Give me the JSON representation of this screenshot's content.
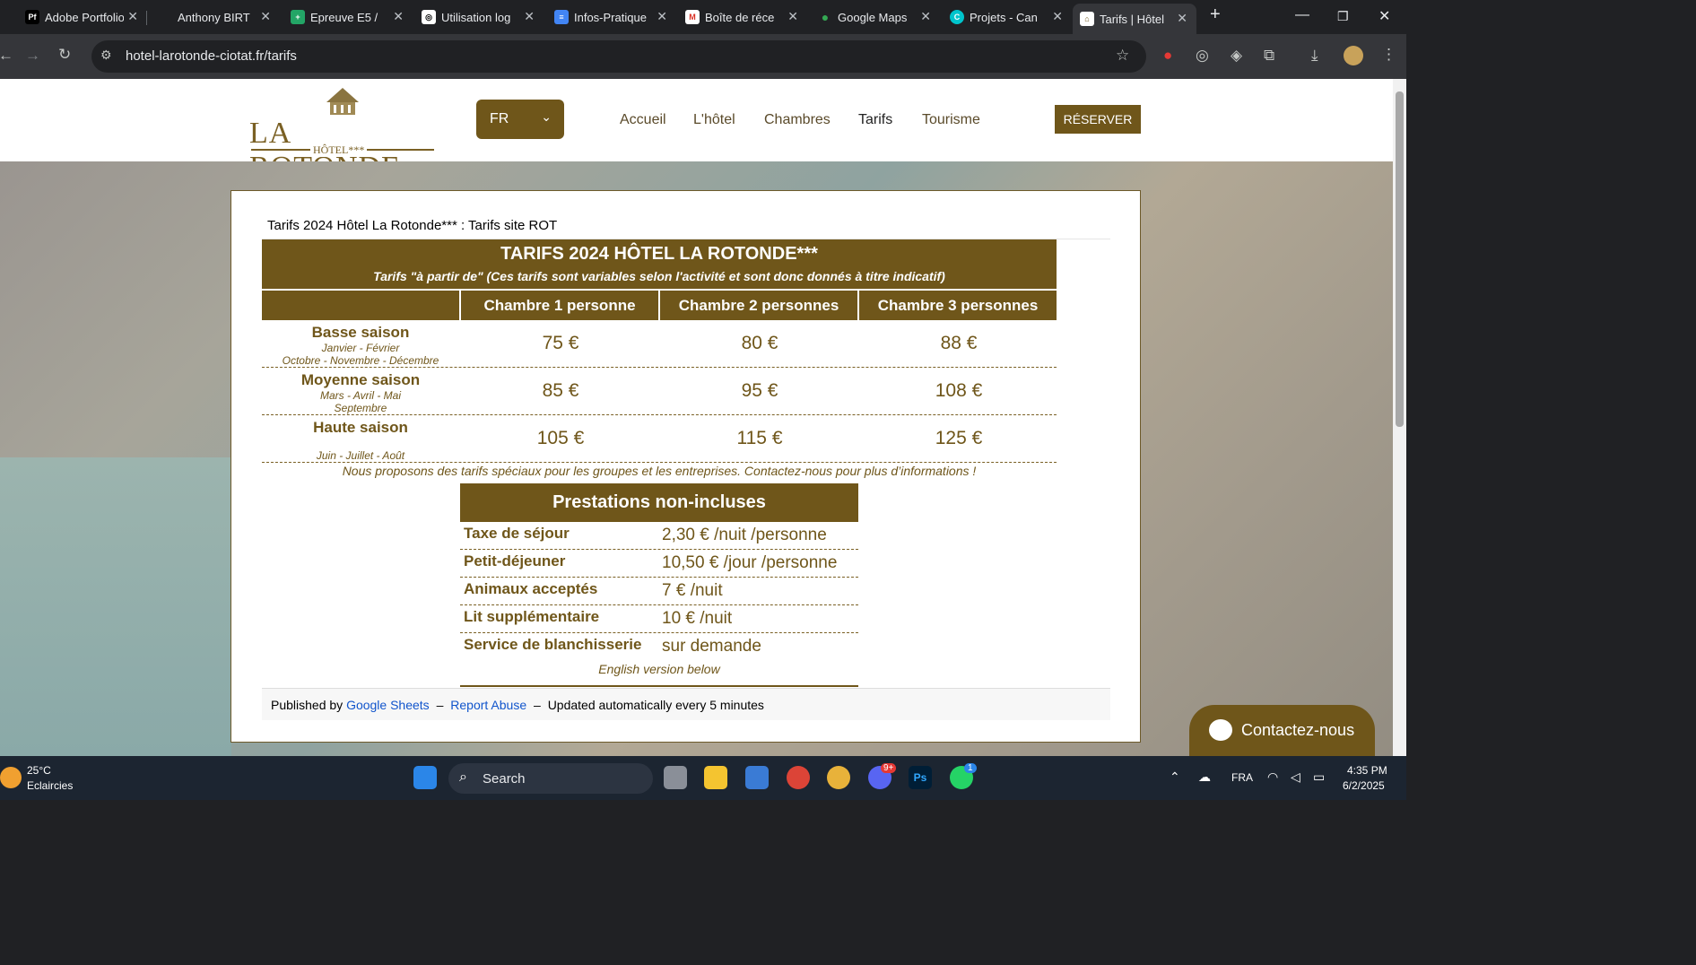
{
  "browser": {
    "tabs": [
      {
        "title": "Adobe Portfolio",
        "fav": "Pf",
        "color": "#000000"
      },
      {
        "title": "Anthony BIRT",
        "fav": "",
        "color": "#202124"
      },
      {
        "title": "Epreuve E5 /",
        "fav": "+",
        "color": "#23a566"
      },
      {
        "title": "Utilisation log",
        "fav": "◎",
        "color": "#202124"
      },
      {
        "title": "Infos-Pratique",
        "fav": "≡",
        "color": "#4285f4"
      },
      {
        "title": "Boîte de réce",
        "fav": "M",
        "color": "#202124"
      },
      {
        "title": "Google Maps",
        "fav": "●",
        "color": "#202124"
      },
      {
        "title": "Projets - Can",
        "fav": "C",
        "color": "#00c4cc"
      },
      {
        "title": "Tarifs | Hôtel",
        "fav": "⌂",
        "color": "#ffffff"
      }
    ],
    "new_tab": "+",
    "url": "hotel-larotonde-ciotat.fr/tarifs"
  },
  "site": {
    "logo_name": "LA ROTONDE",
    "logo_sub": "HÔTEL***",
    "lang": "FR",
    "nav": [
      "Accueil",
      "L'hôtel",
      "Chambres",
      "Tarifs",
      "Tourisme"
    ],
    "reserve": "RÉSERVER",
    "chat": "Contactez-nous"
  },
  "sheet": {
    "doc_title": "Tarifs 2024 Hôtel La Rotonde*** : Tarifs site ROT",
    "title": "TARIFS 2024 HÔTEL LA ROTONDE***",
    "subtitle": "Tarifs \"à partir de\" (Ces tarifs sont variables selon l'activité et sont donc donnés à titre indicatif)",
    "columns": [
      "Chambre 1 personne",
      "Chambre 2 personnes",
      "Chambre 3 personnes"
    ],
    "rows": [
      {
        "season": "Basse saison",
        "m1": "Janvier - Février",
        "m2": "Octobre - Novembre - Décembre",
        "p1": "75 €",
        "p2": "80 €",
        "p3": "88 €"
      },
      {
        "season": "Moyenne saison",
        "m1": "Mars - Avril - Mai",
        "m2": "Septembre",
        "p1": "85 €",
        "p2": "95 €",
        "p3": "108 €"
      },
      {
        "season": "Haute saison",
        "m1": "",
        "m2": "Juin - Juillet - Août",
        "p1": "105 €",
        "p2": "115 €",
        "p3": "125 €"
      }
    ],
    "note": "Nous proposons des tarifs spéciaux pour les groupes et les entreprises. Contactez-nous pour plus d’informations !",
    "prest_title": "Prestations non-incluses",
    "prestations": [
      {
        "k": "Taxe de séjour",
        "v": "2,30 € /nuit /personne"
      },
      {
        "k": "Petit-déjeuner",
        "v": "10,50 € /jour /personne"
      },
      {
        "k": "Animaux acceptés",
        "v": "7 € /nuit"
      },
      {
        "k": "Lit supplémentaire",
        "v": "10 € /nuit"
      },
      {
        "k": "Service de blanchisserie",
        "v": "sur demande"
      }
    ],
    "english": "English version below",
    "published_by": "Published by",
    "google_sheets": "Google Sheets",
    "dash": "–",
    "report_abuse": "Report Abuse",
    "updated": "Updated automatically every 5 minutes"
  },
  "taskbar": {
    "temp": "25°C",
    "weather": "Eclaircies",
    "search": "Search",
    "lang": "FRA",
    "time": "4:35 PM",
    "date": "6/2/2025",
    "discord_badge": "9+",
    "whatsapp_badge": "1"
  }
}
